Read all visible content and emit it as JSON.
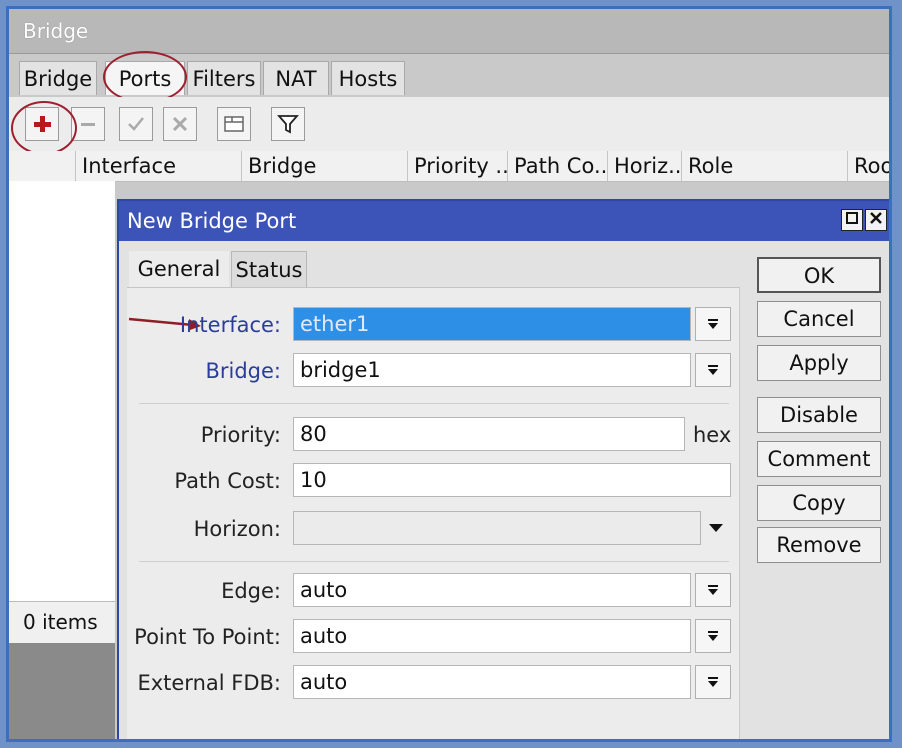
{
  "window": {
    "title": "Bridge"
  },
  "tabs": [
    "Bridge",
    "Ports",
    "Filters",
    "NAT",
    "Hosts"
  ],
  "active_tab": "Ports",
  "columns": [
    "Interface",
    "Bridge",
    "Priority ...",
    "Path Co...",
    "Horiz...",
    "Role",
    "Roo"
  ],
  "status": {
    "items": "0 items"
  },
  "dialog": {
    "title": "New Bridge Port",
    "tabs": [
      "General",
      "Status"
    ],
    "fields": {
      "interface": {
        "label": "Interface:",
        "value": "ether1"
      },
      "bridge": {
        "label": "Bridge:",
        "value": "bridge1"
      },
      "priority": {
        "label": "Priority:",
        "value": "80",
        "unit": "hex"
      },
      "path_cost": {
        "label": "Path Cost:",
        "value": "10"
      },
      "horizon": {
        "label": "Horizon:",
        "value": ""
      },
      "edge": {
        "label": "Edge:",
        "value": "auto"
      },
      "point_to_point": {
        "label": "Point To Point:",
        "value": "auto"
      },
      "external_fdb": {
        "label": "External FDB:",
        "value": "auto"
      }
    },
    "buttons": [
      "OK",
      "Cancel",
      "Apply",
      "Disable",
      "Comment",
      "Copy",
      "Remove"
    ]
  },
  "colors": {
    "accent": "#3c53b8",
    "highlight_circle": "#9c2130",
    "selection": "#2e8fe6"
  }
}
